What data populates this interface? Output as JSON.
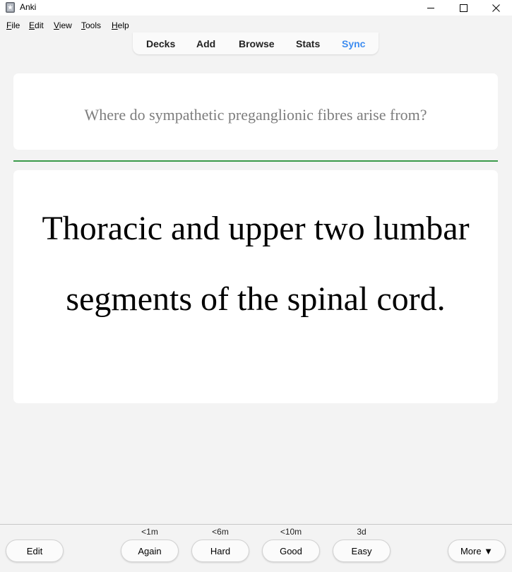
{
  "window": {
    "title": "Anki",
    "icon": "anki-star-icon"
  },
  "menu": {
    "items": [
      {
        "label": "File",
        "mnemonic": "F",
        "rest": "ile"
      },
      {
        "label": "Edit",
        "mnemonic": "E",
        "rest": "dit"
      },
      {
        "label": "View",
        "mnemonic": "V",
        "rest": "iew"
      },
      {
        "label": "Tools",
        "mnemonic": "T",
        "rest": "ools"
      },
      {
        "label": "Help",
        "mnemonic": "H",
        "rest": "elp"
      }
    ]
  },
  "toolbar": {
    "links": [
      "Decks",
      "Add",
      "Browse",
      "Stats",
      "Sync"
    ],
    "sync_color": "#3d8cf0"
  },
  "card": {
    "question": "Where do sympathetic preganglionic fibres arise from?",
    "answer": "Thoracic and upper two lumbar segments of the spinal cord.",
    "divider_color": "#3b9a4a"
  },
  "bottom": {
    "edit_label": "Edit",
    "more_label": "More ▼",
    "answers": [
      {
        "label": "Again",
        "interval": "<1m"
      },
      {
        "label": "Hard",
        "interval": "<6m"
      },
      {
        "label": "Good",
        "interval": "<10m"
      },
      {
        "label": "Easy",
        "interval": "3d"
      }
    ]
  }
}
